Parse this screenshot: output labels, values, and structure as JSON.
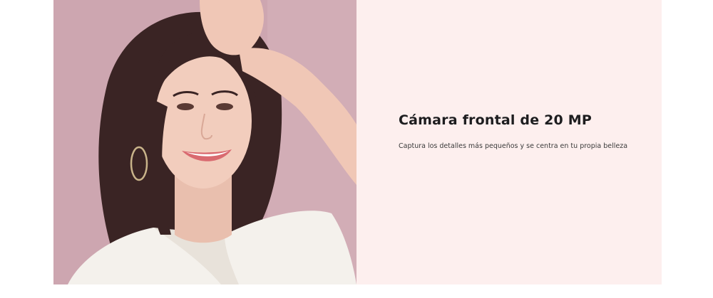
{
  "feature": {
    "title": "Cámara frontal de 20 MP",
    "description": "Captura los detalles más pequeños y se centra en tu propia belleza"
  },
  "colors": {
    "panel_background": "#fdefee",
    "photo_background": "#cfa9b2",
    "title_color": "#1d1d1f",
    "text_color": "#3a3a3a"
  }
}
